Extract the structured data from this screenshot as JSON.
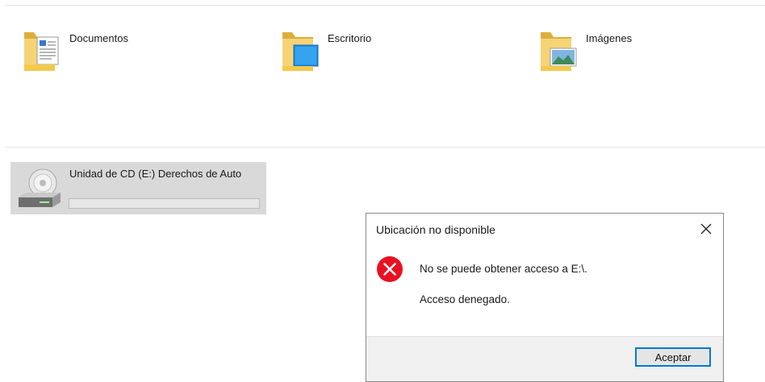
{
  "folders": [
    {
      "label": "Documentos",
      "icon": "documents-folder-icon"
    },
    {
      "label": "Escritorio",
      "icon": "desktop-folder-icon"
    },
    {
      "label": "Imágenes",
      "icon": "pictures-folder-icon"
    }
  ],
  "drive": {
    "label": "Unidad de CD (E:) Derechos de Auto",
    "icon": "cd-drive-icon",
    "usage_fraction": 0
  },
  "dialog": {
    "title": "Ubicación no disponible",
    "message": "No se puede obtener acceso a E:\\.",
    "detail": "Acceso denegado.",
    "ok_label": "Aceptar",
    "close_icon": "close-icon",
    "status_icon": "error-icon"
  },
  "colors": {
    "folder": "#f2c94c",
    "accent": "#0078d7",
    "error": "#e81123",
    "drive_tile": "#d9d9d9"
  }
}
